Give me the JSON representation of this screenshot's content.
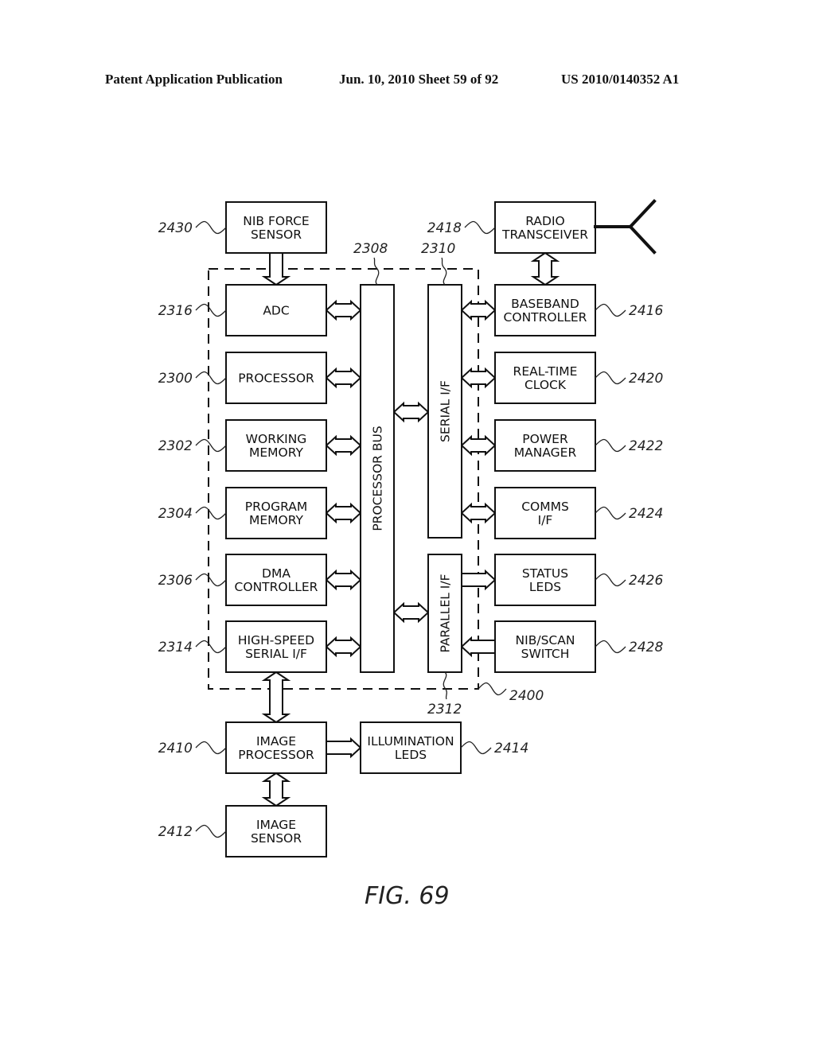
{
  "header": {
    "publication": "Patent Application Publication",
    "date_sheet": "Jun. 10, 2010  Sheet 59 of 92",
    "pub_number": "US 2010/0140352 A1"
  },
  "figure_label": "FIG. 69",
  "blocks": {
    "nib_force_sensor": {
      "lines": [
        "NIB FORCE",
        "SENSOR"
      ],
      "ref": "2430"
    },
    "adc": {
      "lines": [
        "ADC"
      ],
      "ref": "2316"
    },
    "processor": {
      "lines": [
        "PROCESSOR"
      ],
      "ref": "2300"
    },
    "working_memory": {
      "lines": [
        "WORKING",
        "MEMORY"
      ],
      "ref": "2302"
    },
    "program_memory": {
      "lines": [
        "PROGRAM",
        "MEMORY"
      ],
      "ref": "2304"
    },
    "dma_controller": {
      "lines": [
        "DMA",
        "CONTROLLER"
      ],
      "ref": "2306"
    },
    "high_speed_serial": {
      "lines": [
        "HIGH-SPEED",
        "SERIAL I/F"
      ],
      "ref": "2314"
    },
    "processor_bus": {
      "lines": [
        "PROCESSOR BUS"
      ],
      "ref": "2308"
    },
    "serial_if": {
      "lines": [
        "SERIAL I/F"
      ],
      "ref": "2310"
    },
    "parallel_if": {
      "lines": [
        "PARALLEL I/F"
      ],
      "ref": "2312"
    },
    "radio_transceiver": {
      "lines": [
        "RADIO",
        "TRANSCEIVER"
      ],
      "ref": "2418"
    },
    "baseband_controller": {
      "lines": [
        "BASEBAND",
        "CONTROLLER"
      ],
      "ref": "2416"
    },
    "real_time_clock": {
      "lines": [
        "REAL-TIME",
        "CLOCK"
      ],
      "ref": "2420"
    },
    "power_manager": {
      "lines": [
        "POWER",
        "MANAGER"
      ],
      "ref": "2422"
    },
    "comms_if": {
      "lines": [
        "COMMS",
        "I/F"
      ],
      "ref": "2424"
    },
    "status_leds": {
      "lines": [
        "STATUS",
        "LEDS"
      ],
      "ref": "2426"
    },
    "nib_scan_switch": {
      "lines": [
        "NIB/SCAN",
        "SWITCH"
      ],
      "ref": "2428"
    },
    "image_processor": {
      "lines": [
        "IMAGE",
        "PROCESSOR"
      ],
      "ref": "2410"
    },
    "illumination_leds": {
      "lines": [
        "ILLUMINATION",
        "LEDS"
      ],
      "ref": "2414"
    },
    "image_sensor": {
      "lines": [
        "IMAGE",
        "SENSOR"
      ],
      "ref": "2412"
    }
  },
  "enclosure_ref": "2400"
}
